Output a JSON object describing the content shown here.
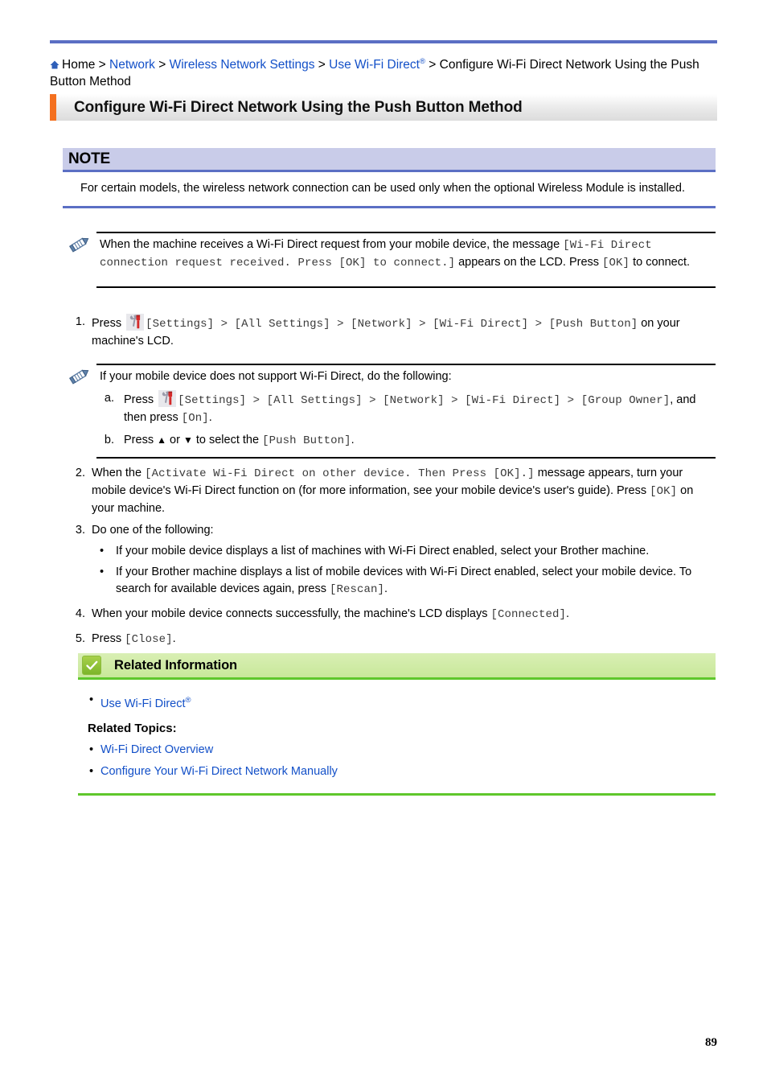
{
  "breadcrumb": {
    "home_icon": "home-icon",
    "home_label": "Home",
    "separator": ">",
    "items": [
      {
        "label": "Network",
        "link": true
      },
      {
        "label": "Wireless Network Settings",
        "link": true
      },
      {
        "label": "Use Wi-Fi Direct",
        "sup": "®",
        "link": true
      },
      {
        "label": "Configure Wi-Fi Direct Network Using the Push Button Method",
        "link": false
      }
    ]
  },
  "title": {
    "text": "Configure Wi-Fi Direct Network Using the Push Button Method",
    "accent_color": "#f4701f"
  },
  "note": {
    "heading": "NOTE",
    "body": "For certain models, the wireless network connection can be used only when the optional Wireless Module is installed.",
    "header_bg": "#c9cce9",
    "rule_color": "#5b6fc4"
  },
  "memo1": {
    "icon": "pencil-icon",
    "text_a": "When the machine receives a Wi-Fi Direct request from your mobile device, the message ",
    "code_a": "[Wi-Fi Direct connection request received. Press [OK] to connect.]",
    "text_b": " appears on the LCD. Press ",
    "code_b": "[OK]",
    "text_c": " to connect."
  },
  "steps": [
    {
      "num": "1.",
      "press_label": "Press",
      "icon": "settings-icon",
      "path": "[Settings] > [All Settings] > [Network] > [Wi-Fi Direct] > [Push Button]",
      "tail": " on your machine's LCD."
    },
    {
      "num": "2.",
      "lead": "When the ",
      "code": "[Activate Wi-Fi Direct on other device. Then Press [OK].]",
      "mid": " message appears, turn your mobile device's Wi-Fi Direct function on (for more information, see your mobile device's user's guide). Press ",
      "code2": "[OK]",
      "tail": " on your machine."
    },
    {
      "num": "3.",
      "text": "Do one of the following:",
      "bullets": [
        {
          "text": "If your mobile device displays a list of machines with Wi-Fi Direct enabled, select your Brother machine."
        },
        {
          "text_a": "If your Brother machine displays a list of mobile devices with Wi-Fi Direct enabled, select your mobile device. To search for available devices again, press ",
          "code": "[Rescan]",
          "text_b": "."
        }
      ]
    },
    {
      "num": "4.",
      "text": "When your mobile device connects successfully, the machine's LCD displays ",
      "code": "[Connected]",
      "tail": "."
    },
    {
      "num": "5.",
      "text": "Press ",
      "code": "[Close]",
      "tail": "."
    }
  ],
  "memo2": {
    "icon": "pencil-icon",
    "intro": "If your mobile device does not support Wi-Fi Direct, do the following:",
    "substeps": [
      {
        "num": "a.",
        "press_label": "Press",
        "icon": "settings-icon",
        "path": "[Settings] > [All Settings] > [Network] > [Wi-Fi Direct] > [Group Owner]",
        "mid": ", and then press ",
        "code": "[On]",
        "tail": "."
      },
      {
        "num": "b.",
        "text_a": "Press ",
        "up_arrow": "▲",
        "or_label": " or ",
        "down_arrow": "▼",
        "text_b": " to select the ",
        "code": "[Push Button]",
        "tail": "."
      }
    ]
  },
  "related": {
    "icon": "check-icon",
    "heading": "Related Information",
    "header_bg": "#c8e89a",
    "rule_color": "#5fc72c",
    "links": [
      {
        "label": "Use Wi-Fi Direct",
        "sup": "®"
      }
    ],
    "topics_label": "Related Topics:",
    "topics": [
      {
        "label": "Wi-Fi Direct Overview"
      },
      {
        "label": "Configure Your Wi-Fi Direct Network Manually"
      }
    ]
  },
  "footer": {
    "page_number": "89"
  },
  "bullet_glyph": "•"
}
